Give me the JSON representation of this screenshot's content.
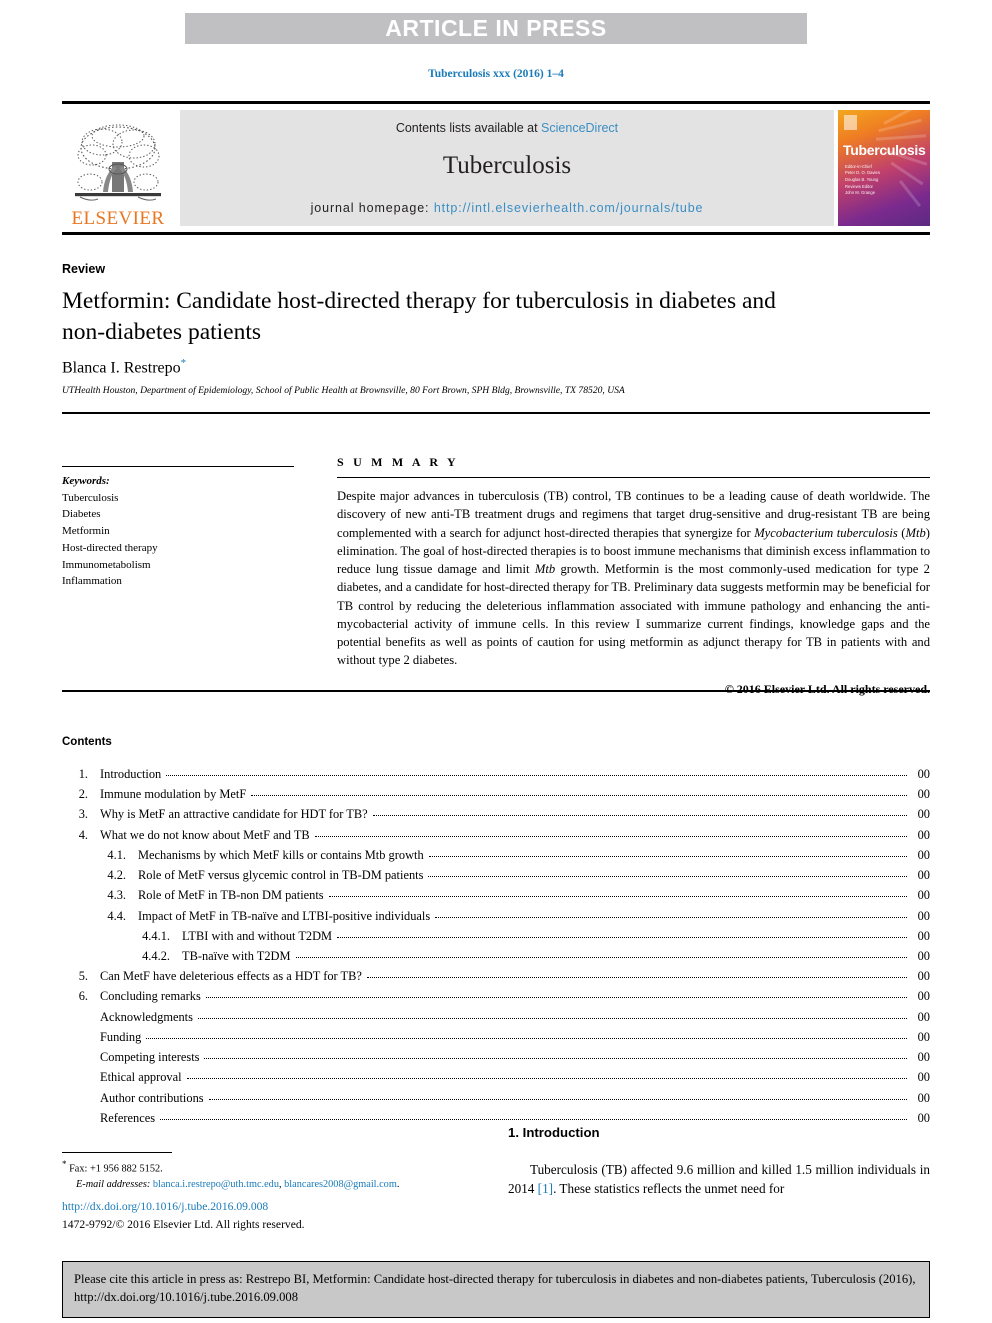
{
  "banner": {
    "text": "ARTICLE IN PRESS"
  },
  "journal_ref": "Tuberculosis xxx (2016) 1–4",
  "masthead": {
    "publisher": "ELSEVIER",
    "contents_line": "Contents lists available at ",
    "contents_link": "ScienceDirect",
    "journal_title": "Tuberculosis",
    "homepage_label": "journal homepage: ",
    "homepage_url": "http://intl.elsevierhealth.com/journals/tube",
    "cover": {
      "title": "Tuberculosis",
      "sub_a": "Editor-in-Chief\nPeter D. O. Davies\nDouglas B. Young",
      "sub_b": "Reviews Editor\nJohn M. Grange"
    }
  },
  "article": {
    "type": "Review",
    "title": "Metformin: Candidate host-directed therapy for tuberculosis in diabetes and non-diabetes patients",
    "author": "Blanca I. Restrepo",
    "author_marker": "*",
    "affiliation": "UTHealth Houston, Department of Epidemiology, School of Public Health at Brownsville, 80 Fort Brown, SPH Bldg, Brownsville, TX 78520, USA"
  },
  "keywords": {
    "heading": "Keywords:",
    "items": [
      "Tuberculosis",
      "Diabetes",
      "Metformin",
      "Host-directed therapy",
      "Immunometabolism",
      "Inflammation"
    ]
  },
  "summary": {
    "heading": "S U M M A R Y",
    "body_1": "Despite major advances in tuberculosis (TB) control, TB continues to be a leading cause of death worldwide. The discovery of new anti-TB treatment drugs and regimens that target drug-sensitive and drug-resistant TB are being complemented with a search for adjunct host-directed therapies that synergize for ",
    "body_italic_1": "Mycobacterium tuberculosis",
    "body_2": " (",
    "body_italic_2": "Mtb",
    "body_3": ") elimination. The goal of host-directed therapies is to boost immune mechanisms that diminish excess inflammation to reduce lung tissue damage and limit ",
    "body_italic_3": "Mtb",
    "body_4": " growth. Metformin is the most commonly-used medication for type 2 diabetes, and a candidate for host-directed therapy for TB. Preliminary data suggests metformin may be beneficial for TB control by reducing the deleterious inflammation associated with immune pathology and enhancing the anti-mycobacterial activity of immune cells. In this review I summarize current findings, knowledge gaps and the potential benefits as well as points of caution for using metformin as adjunct therapy for TB in patients with and without type 2 diabetes.",
    "copyright": "© 2016 Elsevier Ltd. All rights reserved."
  },
  "contents": {
    "heading": "Contents",
    "entries": [
      {
        "level": 1,
        "num": "1.",
        "label": "Introduction",
        "page": "00"
      },
      {
        "level": 1,
        "num": "2.",
        "label": "Immune modulation by MetF",
        "page": "00"
      },
      {
        "level": 1,
        "num": "3.",
        "label": "Why is MetF an attractive candidate for HDT for TB?",
        "page": "00"
      },
      {
        "level": 1,
        "num": "4.",
        "label": "What we do not know about MetF and TB",
        "page": "00"
      },
      {
        "level": 2,
        "num": "4.1.",
        "label": "Mechanisms by which MetF kills or contains Mtb growth",
        "page": "00"
      },
      {
        "level": 2,
        "num": "4.2.",
        "label": "Role of MetF versus glycemic control in TB-DM patients",
        "page": "00"
      },
      {
        "level": 2,
        "num": "4.3.",
        "label": "Role of MetF in TB-non DM patients",
        "page": "00"
      },
      {
        "level": 2,
        "num": "4.4.",
        "label": "Impact of MetF in TB-naïve and LTBI-positive individuals",
        "page": "00"
      },
      {
        "level": 3,
        "num": "4.4.1.",
        "label": "LTBI with and without T2DM",
        "page": "00"
      },
      {
        "level": 3,
        "num": "4.4.2.",
        "label": "TB-naïve with T2DM",
        "page": "00"
      },
      {
        "level": 1,
        "num": "5.",
        "label": "Can MetF have deleterious effects as a HDT for TB?",
        "page": "00"
      },
      {
        "level": 1,
        "num": "6.",
        "label": "Concluding remarks",
        "page": "00"
      },
      {
        "level": 0,
        "num": "",
        "label": "Acknowledgments",
        "page": "00"
      },
      {
        "level": 0,
        "num": "",
        "label": "Funding",
        "page": "00"
      },
      {
        "level": 0,
        "num": "",
        "label": "Competing interests",
        "page": "00"
      },
      {
        "level": 0,
        "num": "",
        "label": "Ethical approval",
        "page": "00"
      },
      {
        "level": 0,
        "num": "",
        "label": "Author contributions",
        "page": "00"
      },
      {
        "level": 0,
        "num": "",
        "label": "References",
        "page": "00"
      }
    ]
  },
  "footnote": {
    "marker": "*",
    "fax": " Fax: +1 956 882 5152.",
    "email_label": "E-mail addresses:",
    "email_1": "blanca.i.restrepo@uth.tmc.edu",
    "email_sep": ", ",
    "email_2": "blancares2008@gmail.com",
    "email_end": "."
  },
  "doi": "http://dx.doi.org/10.1016/j.tube.2016.09.008",
  "issn": "1472-9792/© 2016 Elsevier Ltd. All rights reserved.",
  "introduction": {
    "heading": "1.  Introduction",
    "body_1": "Tuberculosis (TB) affected 9.6 million and killed 1.5 million individuals in 2014 ",
    "citation": "[1]",
    "body_2": ". These statistics reflects the unmet need for"
  },
  "cite_box": {
    "text": "Please cite this article in press as: Restrepo BI, Metformin: Candidate host-directed therapy for tuberculosis in diabetes and non-diabetes patients, Tuberculosis (2016), http://dx.doi.org/10.1016/j.tube.2016.09.008"
  },
  "colors": {
    "link": "#1a7bb9",
    "banner_bg": "#c0c0c2",
    "contents_bg": "#e3e3e3",
    "elsevier_orange": "#e87722",
    "cite_box_bg": "#c8c8c8"
  }
}
